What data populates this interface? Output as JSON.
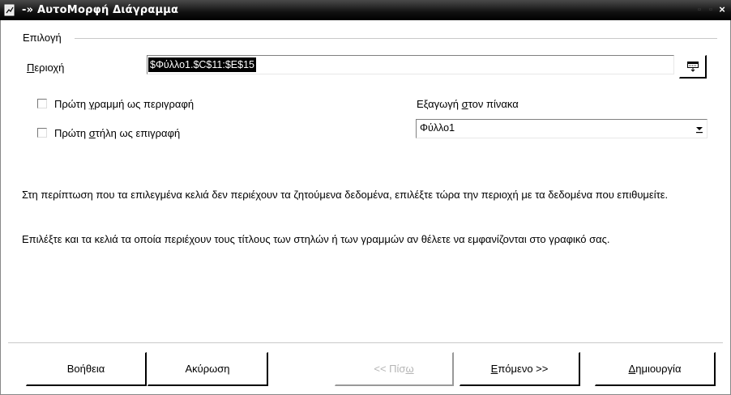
{
  "window": {
    "title": "ΑυτοΜορφή Διάγραμμα",
    "menu_glyph": "-»",
    "close": "×"
  },
  "selection_group": {
    "label": "Επιλογή"
  },
  "range": {
    "label": "Περιοχή",
    "label_accesskey": "Π",
    "label_rest": "εριοχή",
    "value": "$Φύλλο1.$C$11:$E$15"
  },
  "options": {
    "first_row_pre": "Πρώτη ",
    "first_row_key": "γ",
    "first_row_post": "ραμμή ως περιγραφή",
    "first_row_checked": false,
    "first_col_pre": "Πρώτη ",
    "first_col_key": "σ",
    "first_col_post": "τήλη ως επιγραφή",
    "first_col_checked": false
  },
  "export": {
    "label_pre": "Εξαγωγή ",
    "label_key": "σ",
    "label_post": "τον πίνακα",
    "selected": "Φύλλο1"
  },
  "info": {
    "paragraph1": "Στη περίπτωση που τα επιλεγμένα κελιά δεν περιέχουν τα ζητούμενα δεδομένα, επιλέξτε τώρα την περιοχή με τα δεδομένα που επιθυμείτε.",
    "paragraph2": "Επιλέξτε και τα κελιά τα οποία περιέχουν τους τίτλους των στηλών ή των γραμμών αν θέλετε να εμφανίζονται στο γραφικό σας."
  },
  "buttons": {
    "help": "Βοήθεια",
    "cancel": "Ακύρωση",
    "back_pre": "<< Πίσ",
    "back_key": "ω",
    "back_enabled": false,
    "next_key": "Ε",
    "next_post": "πόμενο >>",
    "create_key": "Δ",
    "create_post": "ημιουργία"
  },
  "colors": {
    "titlebar": "#000000",
    "selection": "#000000",
    "disabled_text": "#b5b5b5"
  }
}
